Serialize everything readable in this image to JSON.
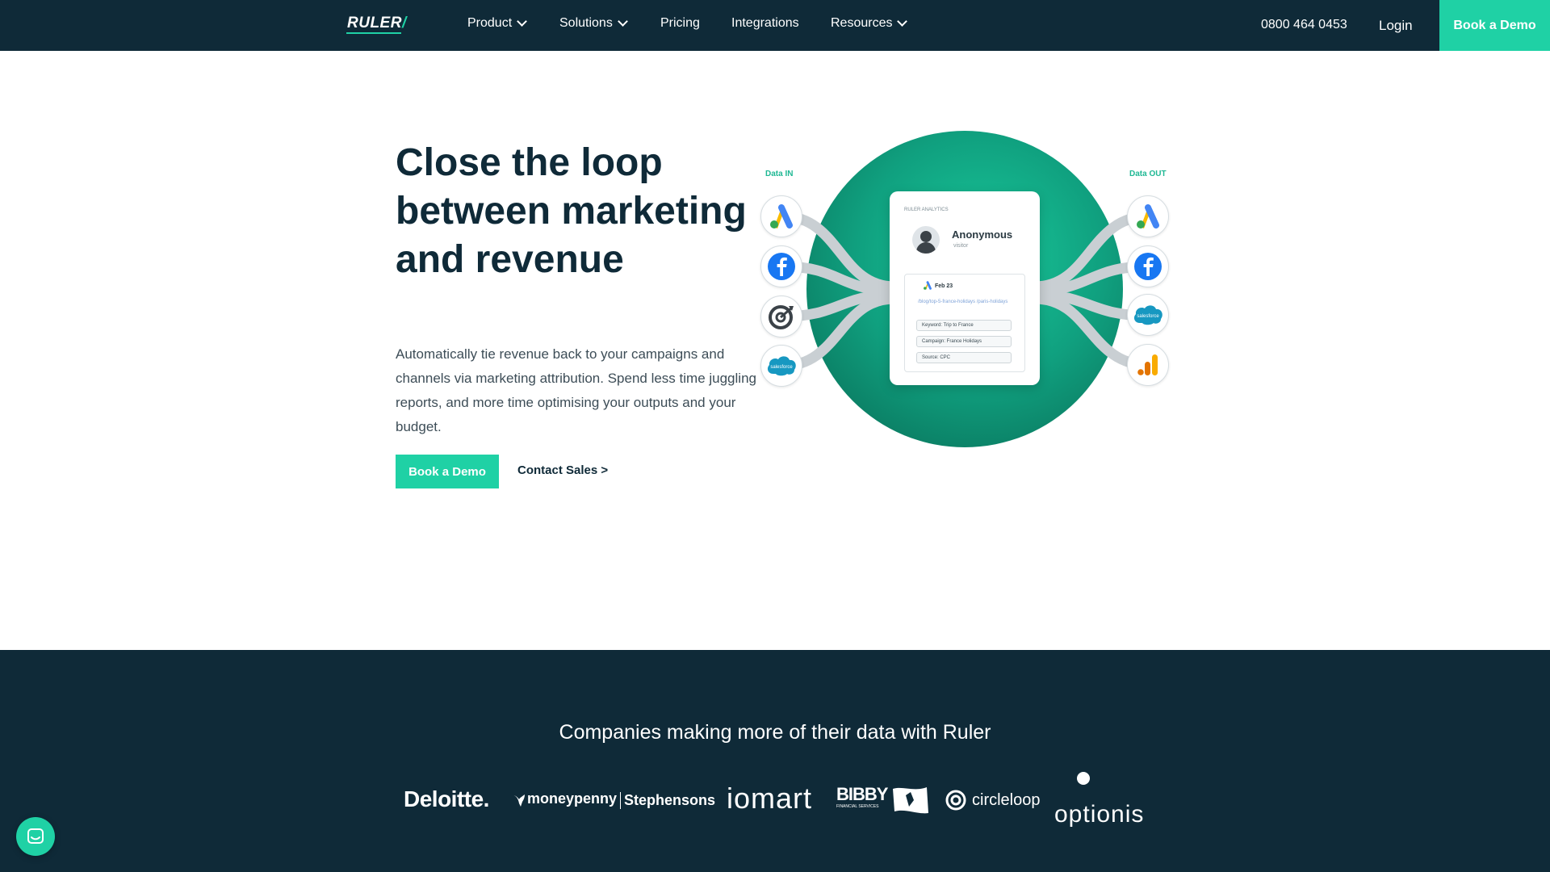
{
  "nav": {
    "logo": "RULER",
    "logo_slash": "/",
    "items": [
      {
        "label": "Product",
        "dropdown": true
      },
      {
        "label": "Solutions",
        "dropdown": true
      },
      {
        "label": "Pricing",
        "dropdown": false
      },
      {
        "label": "Integrations",
        "dropdown": false
      },
      {
        "label": "Resources",
        "dropdown": true
      }
    ],
    "phone": "0800 464 0453",
    "login": "Login",
    "cta": "Book a Demo"
  },
  "hero": {
    "title": "Close the loop between marketing and revenue",
    "description": "Automatically tie revenue back to your campaigns and channels via marketing attribution. Spend less time juggling reports, and more time optimising your outputs and your budget.",
    "primary_button": "Book a Demo",
    "secondary_button": "Contact Sales >"
  },
  "illustration": {
    "data_in_label": "Data IN",
    "data_out_label": "Data OUT",
    "card": {
      "brand": "RULER ANALYTICS",
      "visitor_name": "Anonymous",
      "visitor_sub": "visitor",
      "date": "Feb 23",
      "url": "/blog/top-5-france-holidays /paris-holidays",
      "pills": [
        "Keyword: Trip to France",
        "Campaign: France Holidays",
        "Source: CPC"
      ]
    },
    "in_icons": [
      "google-ads-icon",
      "facebook-icon",
      "target-icon",
      "salesforce-icon"
    ],
    "out_icons": [
      "google-ads-icon",
      "facebook-icon",
      "salesforce-icon",
      "google-analytics-icon"
    ],
    "salesforce_text": "salesforce"
  },
  "logos_section": {
    "title": "Companies making more of their data with Ruler",
    "logos": [
      "Deloitte.",
      "moneypenny",
      "Stephensons",
      "iomart",
      "BIBBY",
      "FINANCIAL SERVICES",
      "circleloop",
      "optionis"
    ]
  },
  "colors": {
    "navy": "#0f2a38",
    "accent": "#1fd1a5",
    "circle": "#12a584"
  }
}
